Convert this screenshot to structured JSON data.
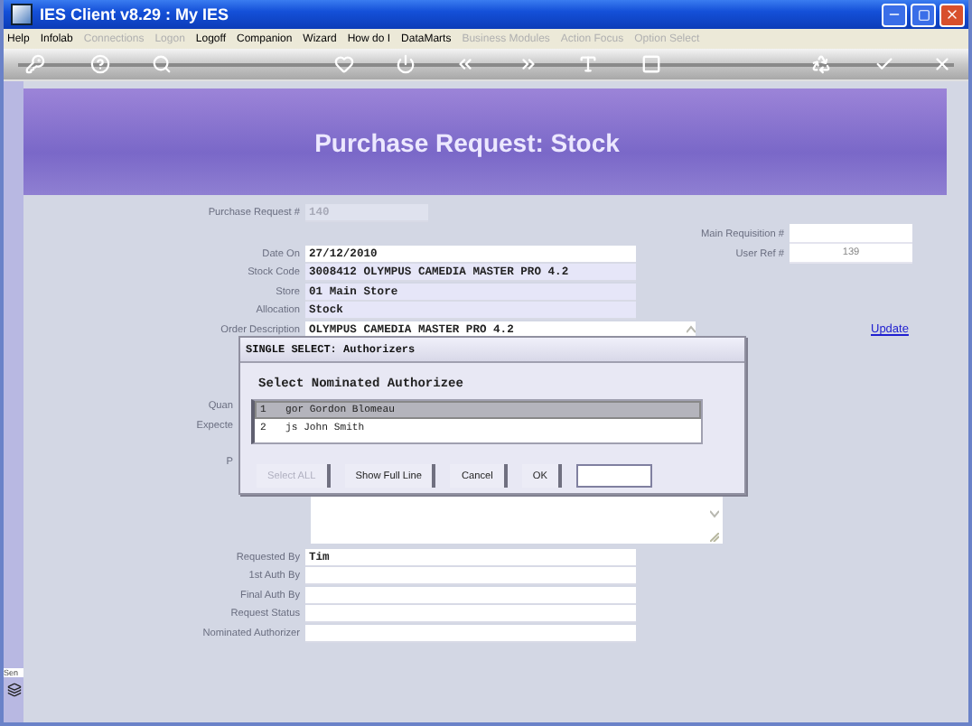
{
  "window": {
    "title": "IES Client v8.29 : My IES"
  },
  "menu": [
    {
      "label": "Help",
      "disabled": false
    },
    {
      "label": "Infolab",
      "disabled": false
    },
    {
      "label": "Connections",
      "disabled": true
    },
    {
      "label": "Logon",
      "disabled": true
    },
    {
      "label": "Logoff",
      "disabled": false
    },
    {
      "label": "Companion",
      "disabled": false
    },
    {
      "label": "Wizard",
      "disabled": false
    },
    {
      "label": "How do I",
      "disabled": false
    },
    {
      "label": "DataMarts",
      "disabled": false
    },
    {
      "label": "Business Modules",
      "disabled": true
    },
    {
      "label": "Action Focus",
      "disabled": true
    },
    {
      "label": "Option Select",
      "disabled": true
    }
  ],
  "page_title": "Purchase Request: Stock",
  "header_fields": [
    {
      "label": "Purchase Request #",
      "value": "140",
      "kind": "readonly"
    }
  ],
  "detail_fields": [
    {
      "label": "Date On",
      "value": "27/12/2010",
      "kind": "plain"
    },
    {
      "label": "Stock Code",
      "value": "3008412 OLYMPUS CAMEDIA MASTER PRO 4.2",
      "kind": "tinted"
    },
    {
      "label": "Store",
      "value": "01 Main Store",
      "kind": "tinted"
    },
    {
      "label": "Allocation",
      "value": "Stock",
      "kind": "tinted"
    },
    {
      "label": "Order Description",
      "value": "OLYMPUS CAMEDIA MASTER PRO 4.2",
      "kind": "memo"
    }
  ],
  "covered_labels": [
    "Quan",
    "Expecte",
    "P"
  ],
  "reference_fields": [
    {
      "label": "Main Requisition #"
    },
    {
      "label": "User Ref #",
      "value": "139"
    }
  ],
  "update_link": "Update",
  "auth_fields": [
    {
      "label": "Requested By",
      "value": "Tim"
    },
    {
      "label": "1st Auth By"
    },
    {
      "label": "Final Auth By"
    },
    {
      "label": "Request Status"
    },
    {
      "label": "Nominated Authorizer"
    }
  ],
  "side_panel": {
    "label": "Sen"
  },
  "dialog": {
    "title": "SINGLE SELECT: Authorizers",
    "heading": "Select Nominated Authorizee",
    "items": [
      {
        "number": "1",
        "text": "gor Gordon Blomeau",
        "selected": true
      },
      {
        "number": "2",
        "text": "js John Smith",
        "selected": false
      }
    ],
    "buttons": [
      {
        "label": "Select ALL",
        "disabled": true
      },
      {
        "label": "Show Full Line",
        "disabled": false
      },
      {
        "label": "Cancel",
        "disabled": false
      },
      {
        "label": "OK",
        "disabled": false
      }
    ]
  }
}
